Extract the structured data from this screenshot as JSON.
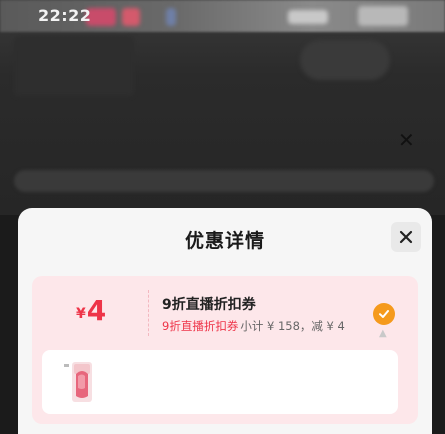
{
  "status_bar": {
    "time": "22:22"
  },
  "sheet": {
    "title": "优惠详情",
    "close_icon": "close-icon"
  },
  "coupon": {
    "currency": "¥",
    "amount": "4",
    "name": "9折直播折扣券",
    "subtitle": "9折直播折扣券",
    "calculation": "小计 ¥ 158，减 ¥ 4",
    "selected": true,
    "check_icon": "check-circle-icon",
    "expand_icon": "chevron-up-icon"
  },
  "product": {
    "thumbnail_icon": "lipstick-product-image"
  },
  "colors": {
    "accent": "#ee3448",
    "check": "#f59a1c",
    "card_bg": "#fde7ea",
    "sheet_bg": "#f6f6f6"
  }
}
